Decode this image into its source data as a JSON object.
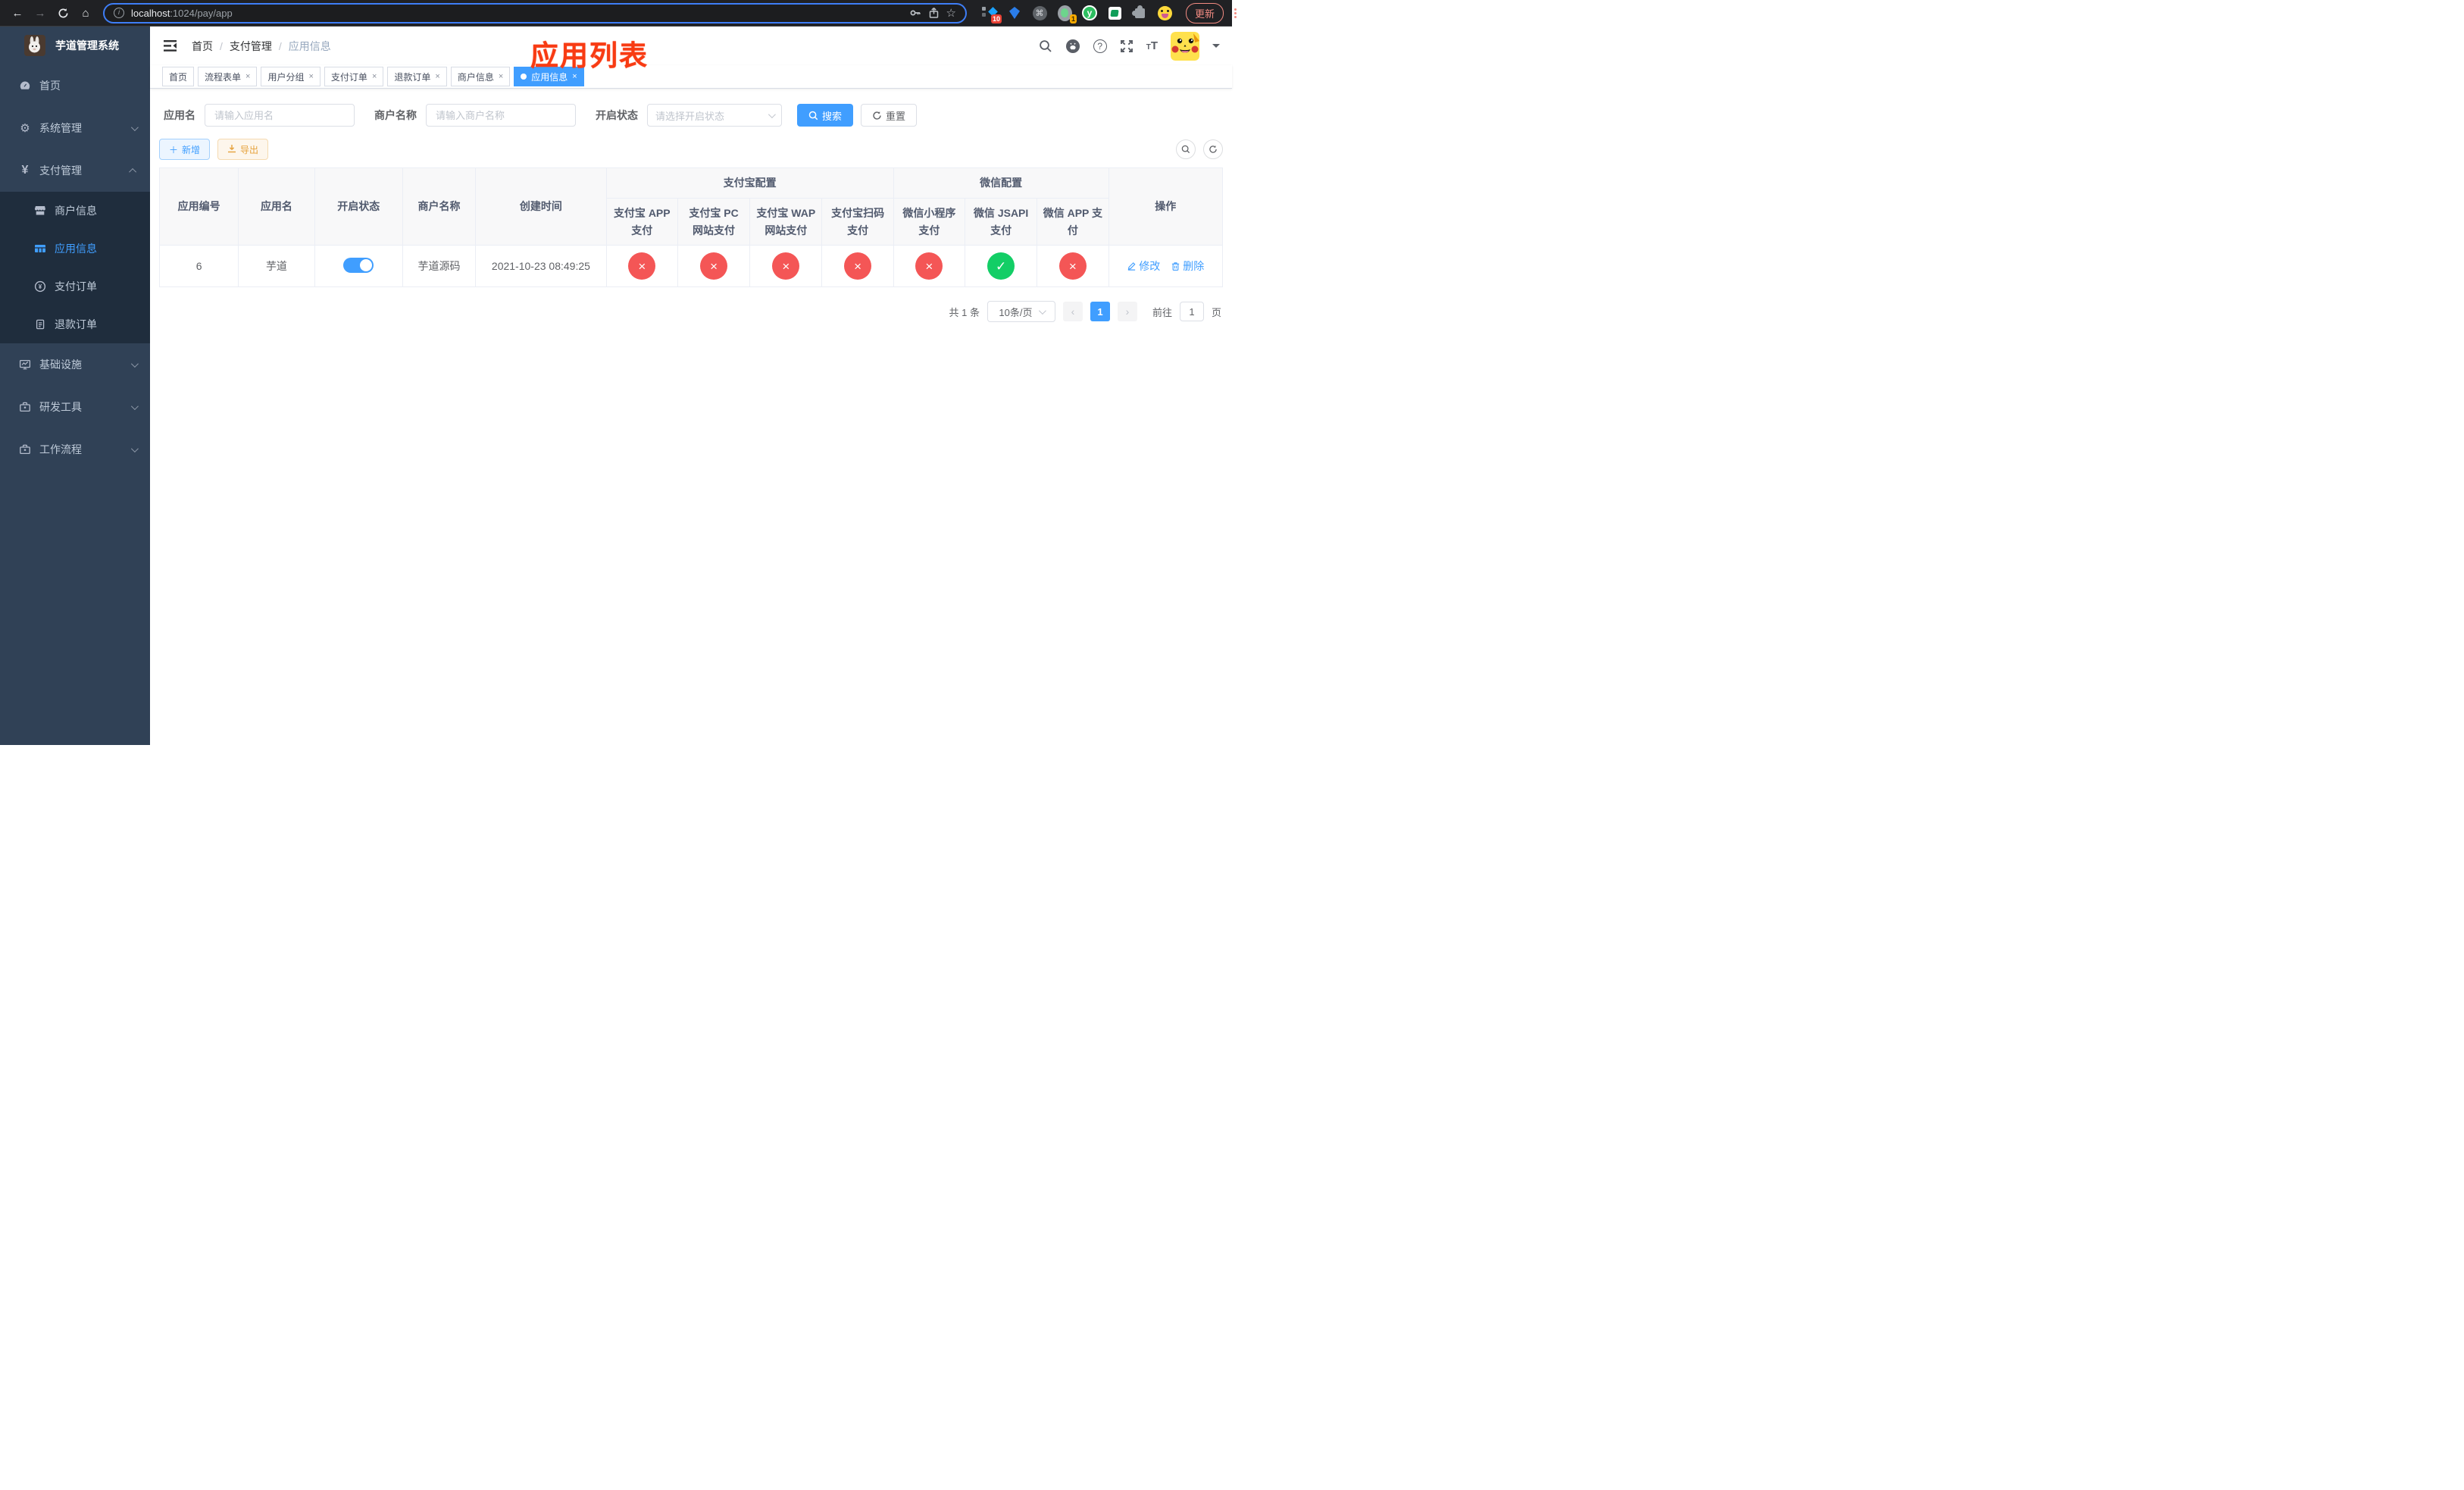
{
  "colors": {
    "accent": "#409eff",
    "success": "#13ce66",
    "danger": "#f45656",
    "warning": "#e6a23c",
    "annotation_red": "#f83b13"
  },
  "browser": {
    "url_host": "localhost",
    "url_path": ":1024/pay/app",
    "update_label": "更新",
    "extensions_badge": "10",
    "profile_badge": "1",
    "cmd_glyph": "⌘",
    "y_glyph": "y"
  },
  "sidebar": {
    "title": "芋道管理系统",
    "items": [
      {
        "label": "首页"
      },
      {
        "label": "系统管理"
      },
      {
        "label": "支付管理"
      },
      {
        "label": "商户信息"
      },
      {
        "label": "应用信息"
      },
      {
        "label": "支付订单"
      },
      {
        "label": "退款订单"
      },
      {
        "label": "基础设施"
      },
      {
        "label": "研发工具"
      },
      {
        "label": "工作流程"
      }
    ]
  },
  "header": {
    "breadcrumb": [
      "首页",
      "支付管理",
      "应用信息"
    ],
    "separator": "/",
    "annotation_title": "应用列表"
  },
  "tabs": [
    {
      "label": "首页"
    },
    {
      "label": "流程表单"
    },
    {
      "label": "用户分组"
    },
    {
      "label": "支付订单"
    },
    {
      "label": "退款订单"
    },
    {
      "label": "商户信息"
    },
    {
      "label": "应用信息"
    }
  ],
  "filters": {
    "app_name_label": "应用名",
    "app_name_placeholder": "请输入应用名",
    "merchant_label": "商户名称",
    "merchant_placeholder": "请输入商户名称",
    "status_label": "开启状态",
    "status_placeholder": "请选择开启状态",
    "search_label": "搜索",
    "reset_label": "重置"
  },
  "toolbar": {
    "add_label": "新增",
    "export_label": "导出"
  },
  "table": {
    "columns": {
      "app_id": "应用编号",
      "app_name": "应用名",
      "status": "开启状态",
      "merchant": "商户名称",
      "created": "创建时间",
      "alipay_group": "支付宝配置",
      "alipay": [
        "支付宝 APP 支付",
        "支付宝 PC 网站支付",
        "支付宝 WAP 网站支付",
        "支付宝扫码支付"
      ],
      "wechat_group": "微信配置",
      "wechat": [
        "微信小程序支付",
        "微信 JSAPI 支付",
        "微信 APP 支付"
      ],
      "action": "操作"
    },
    "rows": [
      {
        "app_id": "6",
        "app_name": "芋道",
        "enabled": true,
        "merchant": "芋道源码",
        "created": "2021-10-23 08:49:25",
        "channels": [
          {
            "name": "alipay-app",
            "enabled": false,
            "glyph": "×"
          },
          {
            "name": "alipay-pc",
            "enabled": false,
            "glyph": "×"
          },
          {
            "name": "alipay-wap",
            "enabled": false,
            "glyph": "×"
          },
          {
            "name": "alipay-qr",
            "enabled": false,
            "glyph": "×"
          },
          {
            "name": "wechat-lite",
            "enabled": false,
            "glyph": "×"
          },
          {
            "name": "wechat-jsapi",
            "enabled": true,
            "glyph": "✓"
          },
          {
            "name": "wechat-app",
            "enabled": false,
            "glyph": "×"
          }
        ],
        "edit_label": "修改",
        "delete_label": "删除"
      }
    ]
  },
  "pagination": {
    "total": "共 1 条",
    "page_size": "10条/页",
    "prev": "‹",
    "current_page": "1",
    "next": "›",
    "goto_label": "前往",
    "goto_value": "1",
    "unit_label": "页"
  }
}
